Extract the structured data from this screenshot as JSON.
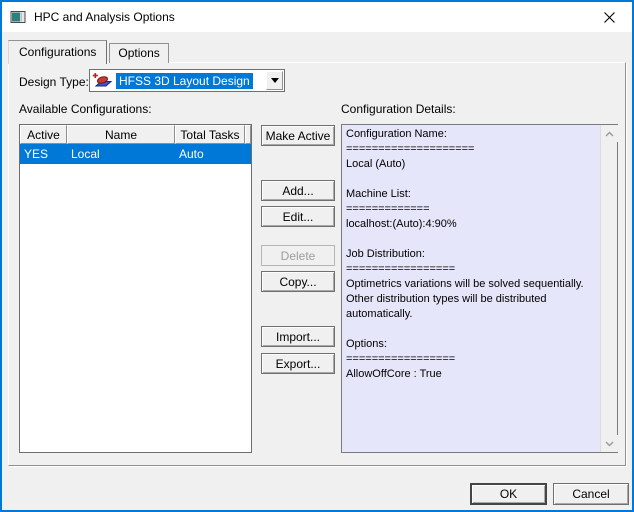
{
  "window": {
    "title": "HPC and Analysis Options",
    "icons": {
      "app": "app-window-icon",
      "close": "close-icon"
    }
  },
  "tabs": [
    {
      "label": "Configurations",
      "active": true
    },
    {
      "label": "Options",
      "active": false
    }
  ],
  "design_type": {
    "label": "Design Type:",
    "selected": "HFSS 3D Layout Design",
    "icon": "hfss-3d-layout-design-icon"
  },
  "available": {
    "label": "Available Configurations:",
    "columns": [
      "Active",
      "Name",
      "Total Tasks"
    ],
    "rows": [
      {
        "active": "YES",
        "name": "Local",
        "total_tasks": "Auto",
        "selected": true
      }
    ]
  },
  "actions": {
    "make_active": "Make Active",
    "add": "Add...",
    "edit": "Edit...",
    "delete": "Delete",
    "copy": "Copy...",
    "import": "Import...",
    "export": "Export..."
  },
  "details": {
    "label": "Configuration Details:",
    "text": "Configuration Name:\n====================\nLocal (Auto)\n\nMachine List:\n=============\nlocalhost:(Auto):4:90%\n\nJob Distribution:\n=================\nOptimetrics variations will be solved sequentially.\nOther distribution types will be distributed\nautomatically.\n\nOptions:\n=================\nAllowOffCore : True"
  },
  "footer": {
    "ok": "OK",
    "cancel": "Cancel"
  },
  "colors": {
    "accent": "#0078d7",
    "selection": "#0078d7",
    "details_bg": "#e6e6fa",
    "disabled_text": "#9d9d9d",
    "dialog_bg": "#f0f0f0"
  }
}
